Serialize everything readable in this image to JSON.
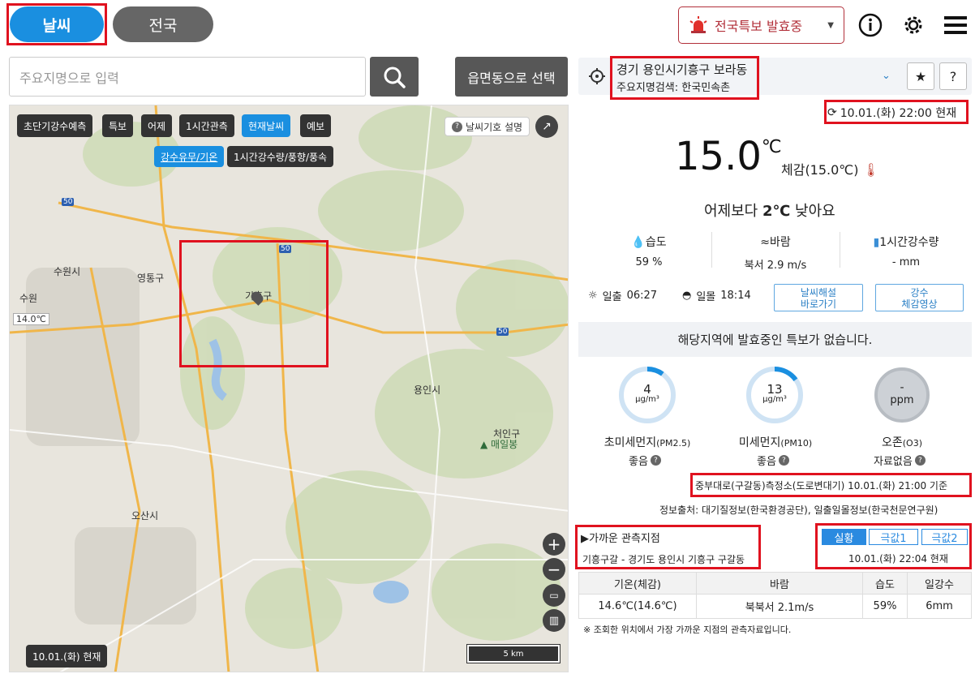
{
  "header": {
    "tab_weather": "날씨",
    "tab_nationwide": "전국",
    "alert_label": "전국특보 발효중"
  },
  "search": {
    "placeholder": "주요지명으로 입력",
    "dong_button": "읍면동으로 선택"
  },
  "map": {
    "buttons": [
      "초단기강수예측",
      "특보",
      "어제",
      "1시간관측",
      "현재날씨",
      "예보"
    ],
    "active_button": "현재날씨",
    "sub_buttons": [
      "강수유무/기온",
      "1시간강수량/풍향/풍속"
    ],
    "legend_link": "날씨기호 설명",
    "places": [
      "수원시",
      "영통구",
      "수원",
      "기흥구",
      "용인시",
      "처인구",
      "매일봉",
      "오산시"
    ],
    "station_temp": "14.0℃",
    "road_numbers": [
      "50",
      "50",
      "50"
    ],
    "footer_time": "10.01.(화) 현재",
    "scale_label": "5 km"
  },
  "location": {
    "name": "경기 용인시기흥구 보라동",
    "sub": "주요지명검색: 한국민속촌",
    "updated": "10.01.(화) 22:00 현재"
  },
  "current": {
    "temperature": "15.0",
    "unit": "℃",
    "feels_like": "체감(15.0℃)",
    "compare_prefix": "어제보다 ",
    "compare_value": "2℃",
    "compare_suffix": " 낮아요",
    "humidity_label": "습도",
    "humidity_value": "59 %",
    "wind_label": "바람",
    "wind_value": "북서 2.9 m/s",
    "rain_label": "1시간강수량",
    "rain_value": "- mm",
    "sunrise_label": "일출",
    "sunrise": "06:27",
    "sunset_label": "일몰",
    "sunset": "18:14",
    "link1": "날씨해설\n바로가기",
    "link2": "강수\n체감영상"
  },
  "notice": "해당지역에 발효중인 특보가 없습니다.",
  "air": {
    "pm25": {
      "value": "4",
      "unit": "μg/m³",
      "name": "초미세먼지",
      "code": "(PM2.5)",
      "grade": "좋음",
      "fraction": 0.1
    },
    "pm10": {
      "value": "13",
      "unit": "μg/m³",
      "name": "미세먼지",
      "code": "(PM10)",
      "grade": "좋음",
      "fraction": 0.15
    },
    "o3": {
      "value": "-",
      "unit": "ppm",
      "name": "오존",
      "code": "(O3)",
      "grade": "자료없음",
      "fraction": 0
    },
    "station": "중부대로(구갈동)측정소(도로변대기) 10.01.(화) 21:00 기준",
    "source": "정보출처: 대기질정보(한국환경공단), 일출일몰정보(한국천문연구원)"
  },
  "observation": {
    "title": "▶가까운 관측지점",
    "station": "기흥구갈 - 경기도 용인시 기흥구 구갈동",
    "tabs": [
      "실황",
      "극값1",
      "극값2"
    ],
    "time": "10.01.(화) 22:04 현재",
    "headers": [
      "기온(체감)",
      "바람",
      "습도",
      "일강수"
    ],
    "row": [
      "14.6℃(14.6℃)",
      "북북서 2.1m/s",
      "59%",
      "6mm"
    ],
    "note": "※ 조회한 위치에서 가장 가까운 지점의 관측자료입니다."
  },
  "colors": {
    "accent": "#1a8fe0",
    "alert": "#b2303a",
    "highlight_box": "#e0121f"
  }
}
